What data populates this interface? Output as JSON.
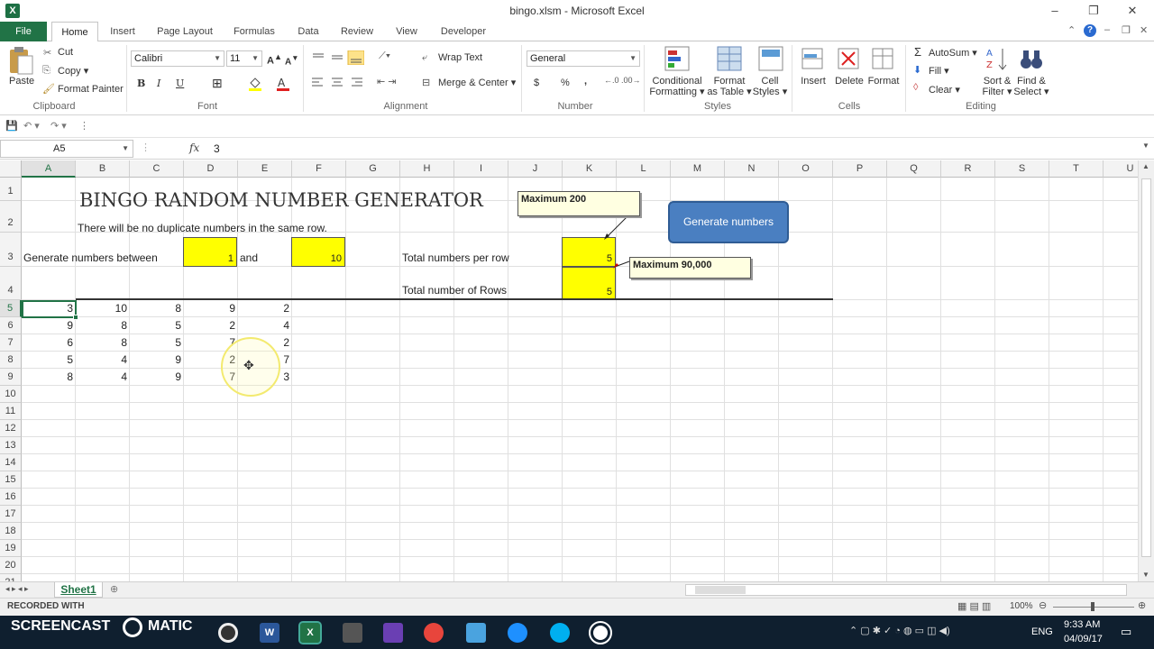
{
  "window": {
    "title": "bingo.xlsm  -  Microsoft Excel",
    "controls": [
      "–",
      "❐",
      "✕"
    ]
  },
  "ribbon_tabs": [
    "File",
    "Home",
    "Insert",
    "Page Layout",
    "Formulas",
    "Data",
    "Review",
    "View",
    "Developer"
  ],
  "ribbon": {
    "clipboard": {
      "paste": "Paste",
      "cut": "Cut",
      "copy": "Copy ▾",
      "format_painter": "Format Painter",
      "label": "Clipboard"
    },
    "font": {
      "name": "Calibri",
      "size": "11",
      "bold": "B",
      "italic": "I",
      "underline": "U",
      "label": "Font"
    },
    "alignment": {
      "wrap": "Wrap Text",
      "merge": "Merge & Center ▾",
      "label": "Alignment"
    },
    "number": {
      "format": "General",
      "currency": "$",
      "percent": "%",
      "comma": ",",
      "label": "Number"
    },
    "styles": {
      "conditional": "Conditional",
      "conditional2": "Formatting ▾",
      "format_table": "Format",
      "format_table2": "as Table ▾",
      "cell_styles": "Cell",
      "cell_styles2": "Styles ▾",
      "label": "Styles"
    },
    "cells": {
      "insert": "Insert",
      "delete": "Delete",
      "format": "Format",
      "label": "Cells"
    },
    "editing": {
      "autosum": "AutoSum ▾",
      "fill": "Fill ▾",
      "clear": "Clear ▾",
      "sort": "Sort &",
      "sort2": "Filter ▾",
      "find": "Find &",
      "find2": "Select ▾",
      "label": "Editing"
    }
  },
  "formula_bar": {
    "name_box": "A5",
    "fx": "fx",
    "value": "3"
  },
  "columns": [
    "A",
    "B",
    "C",
    "D",
    "E",
    "F",
    "G",
    "H",
    "I",
    "J",
    "K",
    "L",
    "M",
    "N",
    "O",
    "P",
    "Q",
    "R",
    "S",
    "T",
    "U"
  ],
  "rows": [
    "1",
    "2",
    "3",
    "4",
    "5",
    "6",
    "7",
    "8",
    "9",
    "10",
    "11",
    "12",
    "13",
    "14",
    "15",
    "16",
    "17",
    "18",
    "19",
    "20",
    "21"
  ],
  "sheet": {
    "title": "BINGO RANDOM NUMBER GENERATOR",
    "subtitle": "There will be no duplicate numbers in the same row.",
    "generate_label": "Generate numbers between",
    "min_value": "1",
    "and_label": "and",
    "max_value": "10",
    "per_row_label": "Total numbers per row",
    "per_row_value": "5",
    "rows_label": "Total number of Rows",
    "rows_value": "5",
    "comment_max200": "Maximum 200",
    "comment_max90000": "Maximum 90,000",
    "button_label": "Generate numbers",
    "table": [
      [
        "3",
        "10",
        "8",
        "9",
        "2"
      ],
      [
        "9",
        "8",
        "5",
        "2",
        "4"
      ],
      [
        "6",
        "8",
        "5",
        "7",
        "2"
      ],
      [
        "5",
        "4",
        "9",
        "2",
        "7"
      ],
      [
        "8",
        "4",
        "9",
        "7",
        "3"
      ]
    ]
  },
  "sheet_tabs": [
    "Sheet1"
  ],
  "status": {
    "left": "RECORDED WITH",
    "zoom": "100%"
  },
  "watermark": "SCREENCAST",
  "watermark2": "MATIC",
  "tray": {
    "lang": "ENG",
    "time": "9:33 AM",
    "date": "04/09/17"
  },
  "colors": {
    "excel_green": "#217346",
    "yellow": "#ffff00",
    "button_blue": "#4a7fc1",
    "taskbar": "#0f1f2f"
  }
}
